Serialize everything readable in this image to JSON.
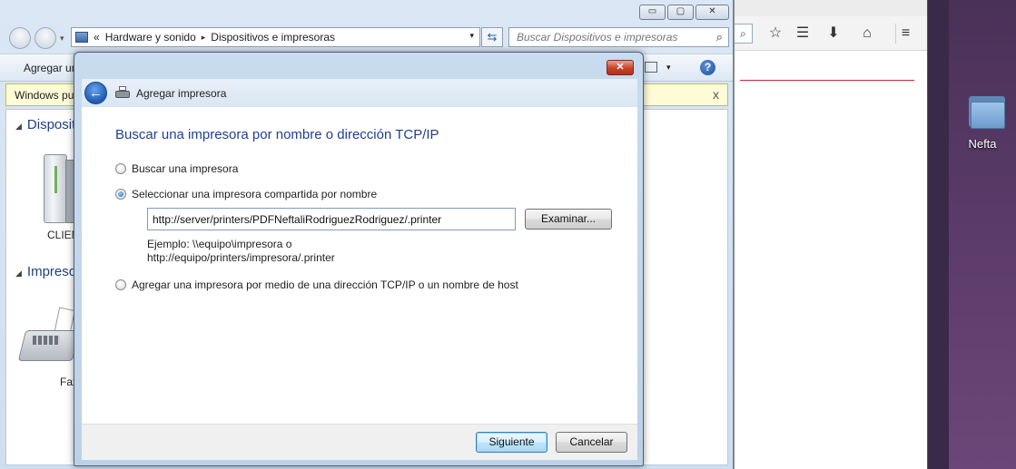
{
  "explorer": {
    "caption_buttons": {
      "minimize": "▭",
      "maximize": "▢",
      "close": "✕"
    },
    "breadcrumb": {
      "root_sep": "«",
      "item1": "Hardware y sonido",
      "sep": "▸",
      "item2": "Dispositivos e impresoras"
    },
    "search": {
      "placeholder": "Buscar Dispositivos e impresoras"
    },
    "toolbar": {
      "add_label": "Agregar un"
    },
    "infobar": {
      "text": "Windows pu",
      "close": "x"
    },
    "groups": {
      "devices": "Disposit",
      "printers": "Impreso"
    },
    "devices": {
      "pc_label": "CLIEN",
      "fax_label": "Fax"
    }
  },
  "browser": {
    "icons": [
      "search-icon",
      "star-icon",
      "reading-list-icon",
      "download-icon",
      "home-icon",
      "menu-icon"
    ]
  },
  "desktop": {
    "folder_label": "Nefta"
  },
  "dialog": {
    "title": "Agregar impresora",
    "close": "✕",
    "heading": "Buscar una impresora por nombre o dirección TCP/IP",
    "option_browse": "Buscar una impresora",
    "option_shared": "Seleccionar una impresora compartida por nombre",
    "shared_path": "http://server/printers/PDFNeftaliRodriguezRodriguez/.printer",
    "browse_button": "Examinar...",
    "example_line1": "Ejemplo: \\\\equipo\\impresora o",
    "example_line2": "http://equipo/printers/impresora/.printer",
    "option_tcpip": "Agregar una impresora por medio de una dirección TCP/IP o un nombre de host",
    "selected_option": "shared",
    "next_button": "Siguiente",
    "cancel_button": "Cancelar"
  }
}
